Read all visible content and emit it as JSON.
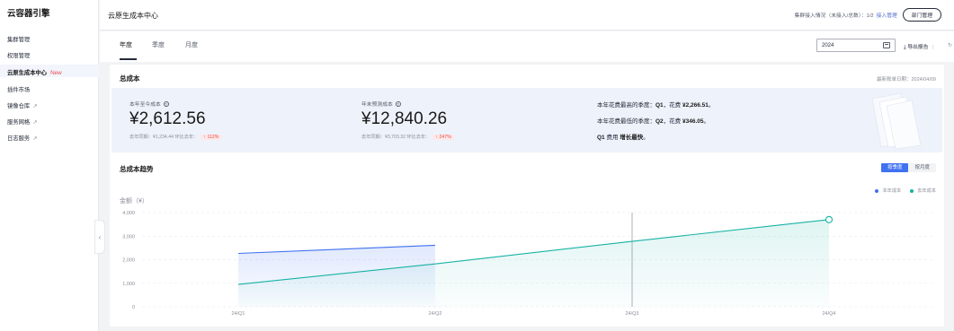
{
  "sidebar": {
    "title": "云容器引擎",
    "items": [
      {
        "label": "集群管理"
      },
      {
        "label": "权限管理"
      },
      {
        "label": "云原生成本中心",
        "badge": "New"
      },
      {
        "label": "插件市场"
      },
      {
        "label": "镜像仓库",
        "external": "↗"
      },
      {
        "label": "服务网格",
        "external": "↗"
      },
      {
        "label": "日志服务",
        "external": "↗"
      }
    ],
    "collapse_icon": "‹"
  },
  "header": {
    "title": "云原生成本中心",
    "cluster_info": "集群接入情况（未接入/总数）：1/2",
    "access_link": "接入管理",
    "dept_button": "部门管理"
  },
  "tabs": [
    {
      "label": "年度"
    },
    {
      "label": "季度"
    },
    {
      "label": "月度"
    }
  ],
  "toolbar": {
    "year_value": "2024",
    "export_label": "导出报告",
    "separator": "|",
    "refresh_icon": "↻"
  },
  "total_cost": {
    "title": "总成本",
    "bill_date": "最新账单日期：2024/04/09",
    "ytd": {
      "label": "本年至今成本",
      "value": "¥2,612.56",
      "compare": "去年同期：¥1,234.44 环比去年：",
      "change": "↑ 112%"
    },
    "forecast": {
      "label": "年末预测成本",
      "value": "¥12,840.26",
      "compare": "去年同期：¥3,703.32 环比去年：",
      "change": "↑ 247%"
    },
    "insights": {
      "high_prefix": "本年花费最高的季度：",
      "high_quarter": "Q1",
      "high_mid": "，花费 ",
      "high_amount": "¥2,266.51",
      "high_end": "。",
      "low_prefix": "本年花费最低的季度：",
      "low_quarter": "Q2",
      "low_mid": "，花费 ",
      "low_amount": "¥346.05",
      "low_end": "。",
      "growth_quarter": "Q1",
      "growth_mid": " 费用 ",
      "growth_bold": "增长最快",
      "growth_end": "。"
    }
  },
  "trend": {
    "title": "总成本趋势",
    "toggle_quarter": "按季度",
    "toggle_month": "按月度",
    "legend_current": "本年成本",
    "legend_last": "去年成本"
  },
  "colors": {
    "current": "#3f71f0",
    "last": "#17b3a4",
    "accent": "#3f71f0"
  },
  "chart_data": {
    "type": "area",
    "ylabel": "金额（¥）",
    "categories": [
      "24/Q1",
      "24/Q2",
      "24/Q3",
      "24/Q4"
    ],
    "yticks": [
      0,
      1000,
      2000,
      3000,
      4000
    ],
    "ytick_labels": [
      "0",
      "1,000",
      "2,000",
      "3,000",
      "4,000"
    ],
    "ylim": [
      0,
      4000
    ],
    "series": [
      {
        "name": "本年成本",
        "values": [
          2266.51,
          2612.56,
          null,
          null
        ]
      },
      {
        "name": "去年成本",
        "values": [
          950,
          1820,
          2780,
          3703.32
        ]
      }
    ],
    "grid": true,
    "legend": "top-right",
    "highlight_category": "24/Q3"
  }
}
